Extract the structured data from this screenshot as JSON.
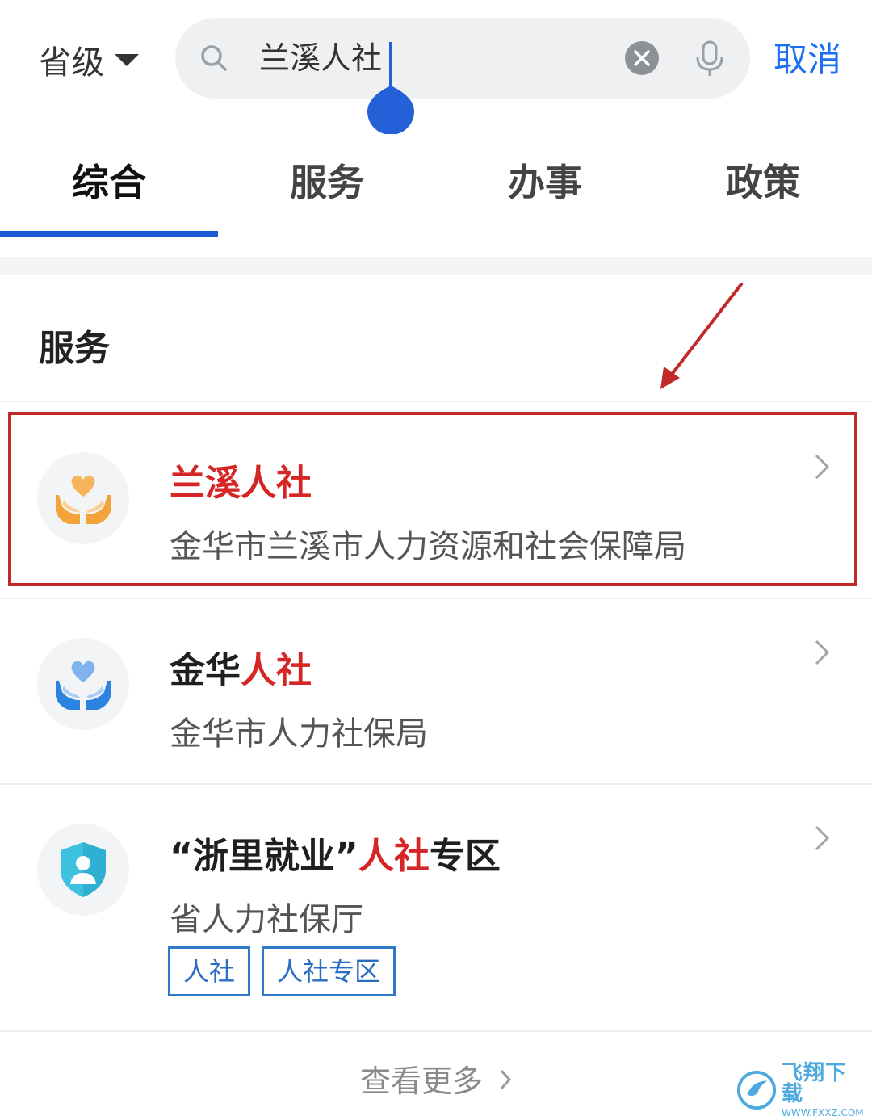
{
  "header": {
    "region_label": "省级",
    "search_value": "兰溪人社",
    "cancel_label": "取消"
  },
  "tabs": [
    {
      "label": "综合",
      "active": true
    },
    {
      "label": "服务",
      "active": false
    },
    {
      "label": "办事",
      "active": false
    },
    {
      "label": "政策",
      "active": false
    }
  ],
  "section": {
    "title": "服务"
  },
  "results": [
    {
      "title_highlight": "兰溪人社",
      "subtitle": "金华市兰溪市人力资源和社会保障局",
      "icon": "heart-hands-icon",
      "icon_color": "#f2a43a"
    },
    {
      "title_prefix": "金华",
      "title_highlight": "人社",
      "subtitle": "金华市人力社保局",
      "icon": "heart-hands-icon",
      "icon_color": "#2d84e0"
    },
    {
      "title_prefix": "“浙里就业”",
      "title_highlight": "人社",
      "title_suffix": "专区",
      "subtitle": "省人力社保厅",
      "icon": "shield-user-icon",
      "icon_color": "#3cc1de",
      "tags": [
        "人社",
        "人社专区"
      ]
    }
  ],
  "more_label": "查看更多",
  "watermark": {
    "main": "飞翔下载",
    "sub": "WWW.FXXZ.COM"
  },
  "colors": {
    "accent": "#1c6ff0",
    "highlight": "#d62525",
    "annotation": "#c22a2a"
  }
}
